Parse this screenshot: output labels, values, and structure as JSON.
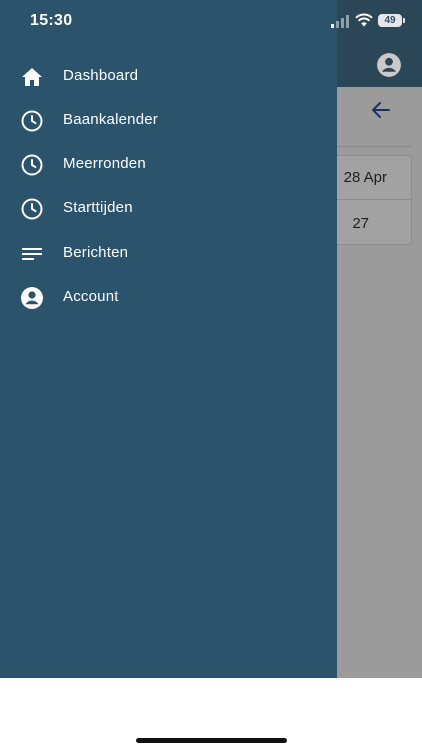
{
  "status_bar": {
    "time": "15:30",
    "battery": "49"
  },
  "background": {
    "card_row1": "28 Apr",
    "card_row2": "27"
  },
  "menu": {
    "items": [
      {
        "label": "Dashboard",
        "icon": "home-icon"
      },
      {
        "label": "Baankalender",
        "icon": "clock-icon"
      },
      {
        "label": "Meerronden",
        "icon": "clock-icon"
      },
      {
        "label": "Starttijden",
        "icon": "clock-icon"
      },
      {
        "label": "Berichten",
        "icon": "lines-icon"
      },
      {
        "label": "Account",
        "icon": "account-icon"
      }
    ]
  },
  "colors": {
    "drawer": "#2b536c",
    "header": "#2b4656",
    "scrim": "#9b9b9b"
  }
}
